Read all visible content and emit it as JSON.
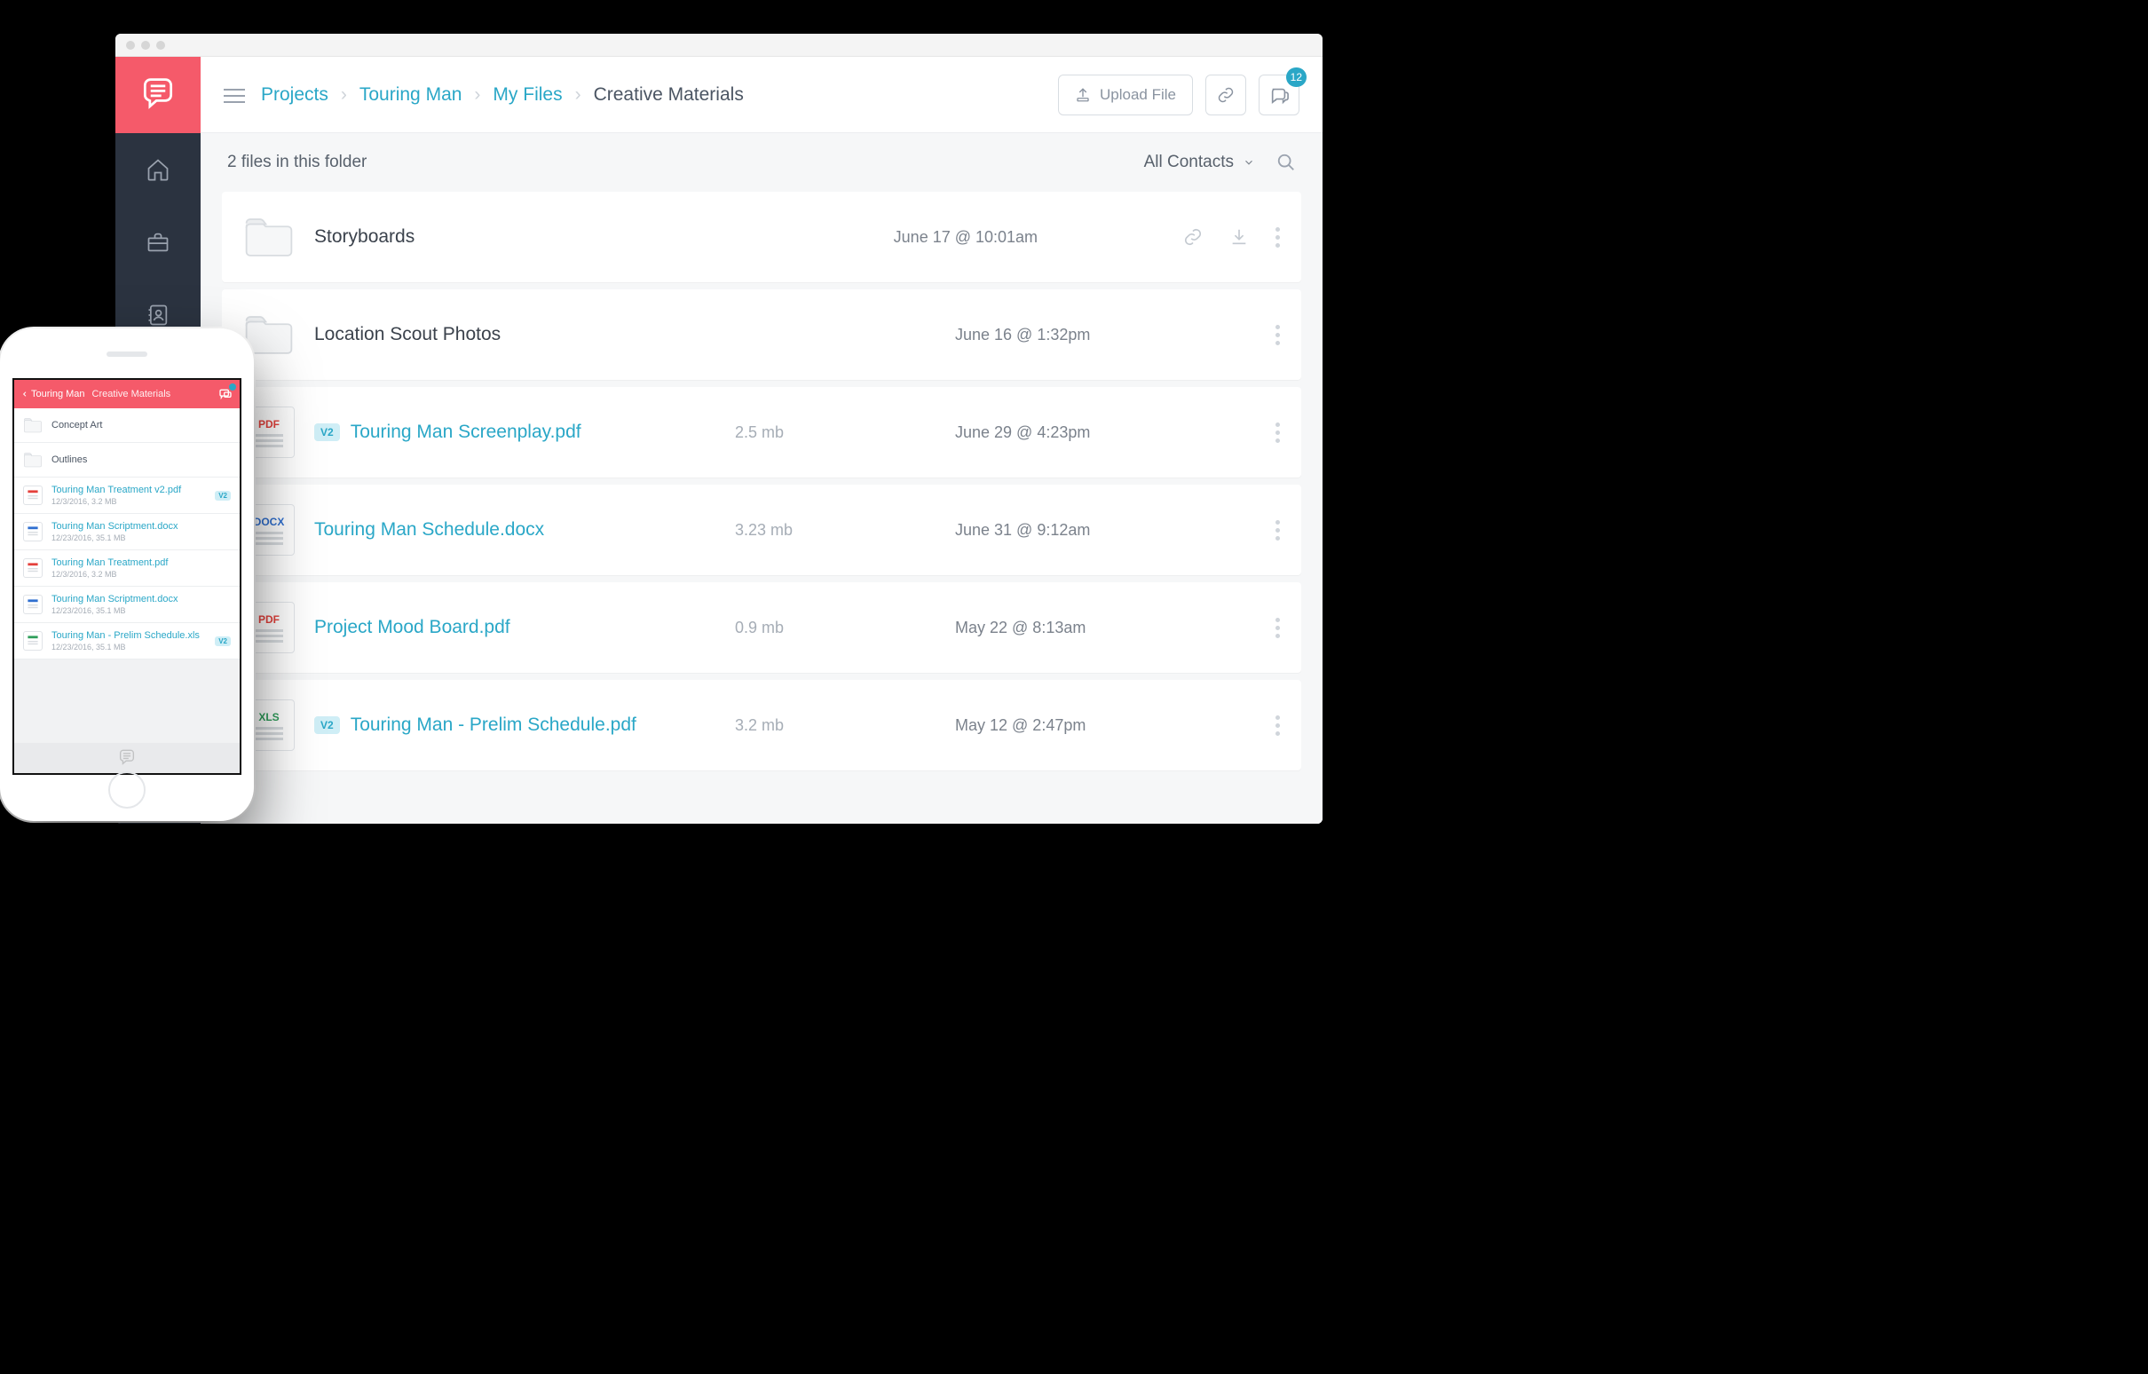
{
  "breadcrumbs": {
    "links": [
      "Projects",
      "Touring Man",
      "My Files"
    ],
    "current": "Creative Materials"
  },
  "topbar": {
    "upload_label": "Upload File",
    "chat_badge": "12"
  },
  "subbar": {
    "summary": "2 files in this folder",
    "filter_label": "All Contacts"
  },
  "rows": [
    {
      "type": "folder",
      "name": "Storyboards",
      "size": "",
      "date": "June 17 @ 10:01am",
      "version": "",
      "link": false,
      "actions": true
    },
    {
      "type": "folder",
      "name": "Location Scout Photos",
      "size": "",
      "date": "June 16 @ 1:32pm",
      "version": "",
      "link": false,
      "actions": false
    },
    {
      "type": "pdf",
      "name": "Touring Man Screenplay.pdf",
      "size": "2.5 mb",
      "date": "June 29 @ 4:23pm",
      "version": "V2",
      "link": true,
      "actions": false
    },
    {
      "type": "docx",
      "name": "Touring Man Schedule.docx",
      "size": "3.23 mb",
      "date": "June 31 @ 9:12am",
      "version": "",
      "link": true,
      "actions": false
    },
    {
      "type": "pdf",
      "name": "Project Mood Board.pdf",
      "size": "0.9 mb",
      "date": "May 22 @ 8:13am",
      "version": "",
      "link": true,
      "actions": false
    },
    {
      "type": "xls",
      "name": "Touring Man - Prelim Schedule.pdf",
      "size": "3.2 mb",
      "date": "May 12 @ 2:47pm",
      "version": "V2",
      "link": true,
      "actions": false
    }
  ],
  "file_labels": {
    "pdf": "PDF",
    "docx": "DOCX",
    "xls": "XLS"
  },
  "phone": {
    "back_label": "Touring Man",
    "title": "Creative Materials",
    "rows": [
      {
        "type": "folder",
        "name": "Concept Art",
        "meta": "",
        "version": "",
        "link": false
      },
      {
        "type": "folder",
        "name": "Outlines",
        "meta": "",
        "version": "",
        "link": false
      },
      {
        "type": "pdf",
        "name": "Touring Man Treatment v2.pdf",
        "meta": "12/3/2016, 3.2 MB",
        "version": "V2",
        "link": true
      },
      {
        "type": "docx",
        "name": "Touring Man Scriptment.docx",
        "meta": "12/23/2016, 35.1 MB",
        "version": "",
        "link": true
      },
      {
        "type": "pdf",
        "name": "Touring Man Treatment.pdf",
        "meta": "12/3/2016, 3.2 MB",
        "version": "",
        "link": true
      },
      {
        "type": "docx",
        "name": "Touring Man Scriptment.docx",
        "meta": "12/23/2016, 35.1 MB",
        "version": "",
        "link": true
      },
      {
        "type": "xls",
        "name": "Touring Man - Prelim Schedule.xls",
        "meta": "12/23/2016, 35.1 MB",
        "version": "V2",
        "link": true
      }
    ]
  }
}
